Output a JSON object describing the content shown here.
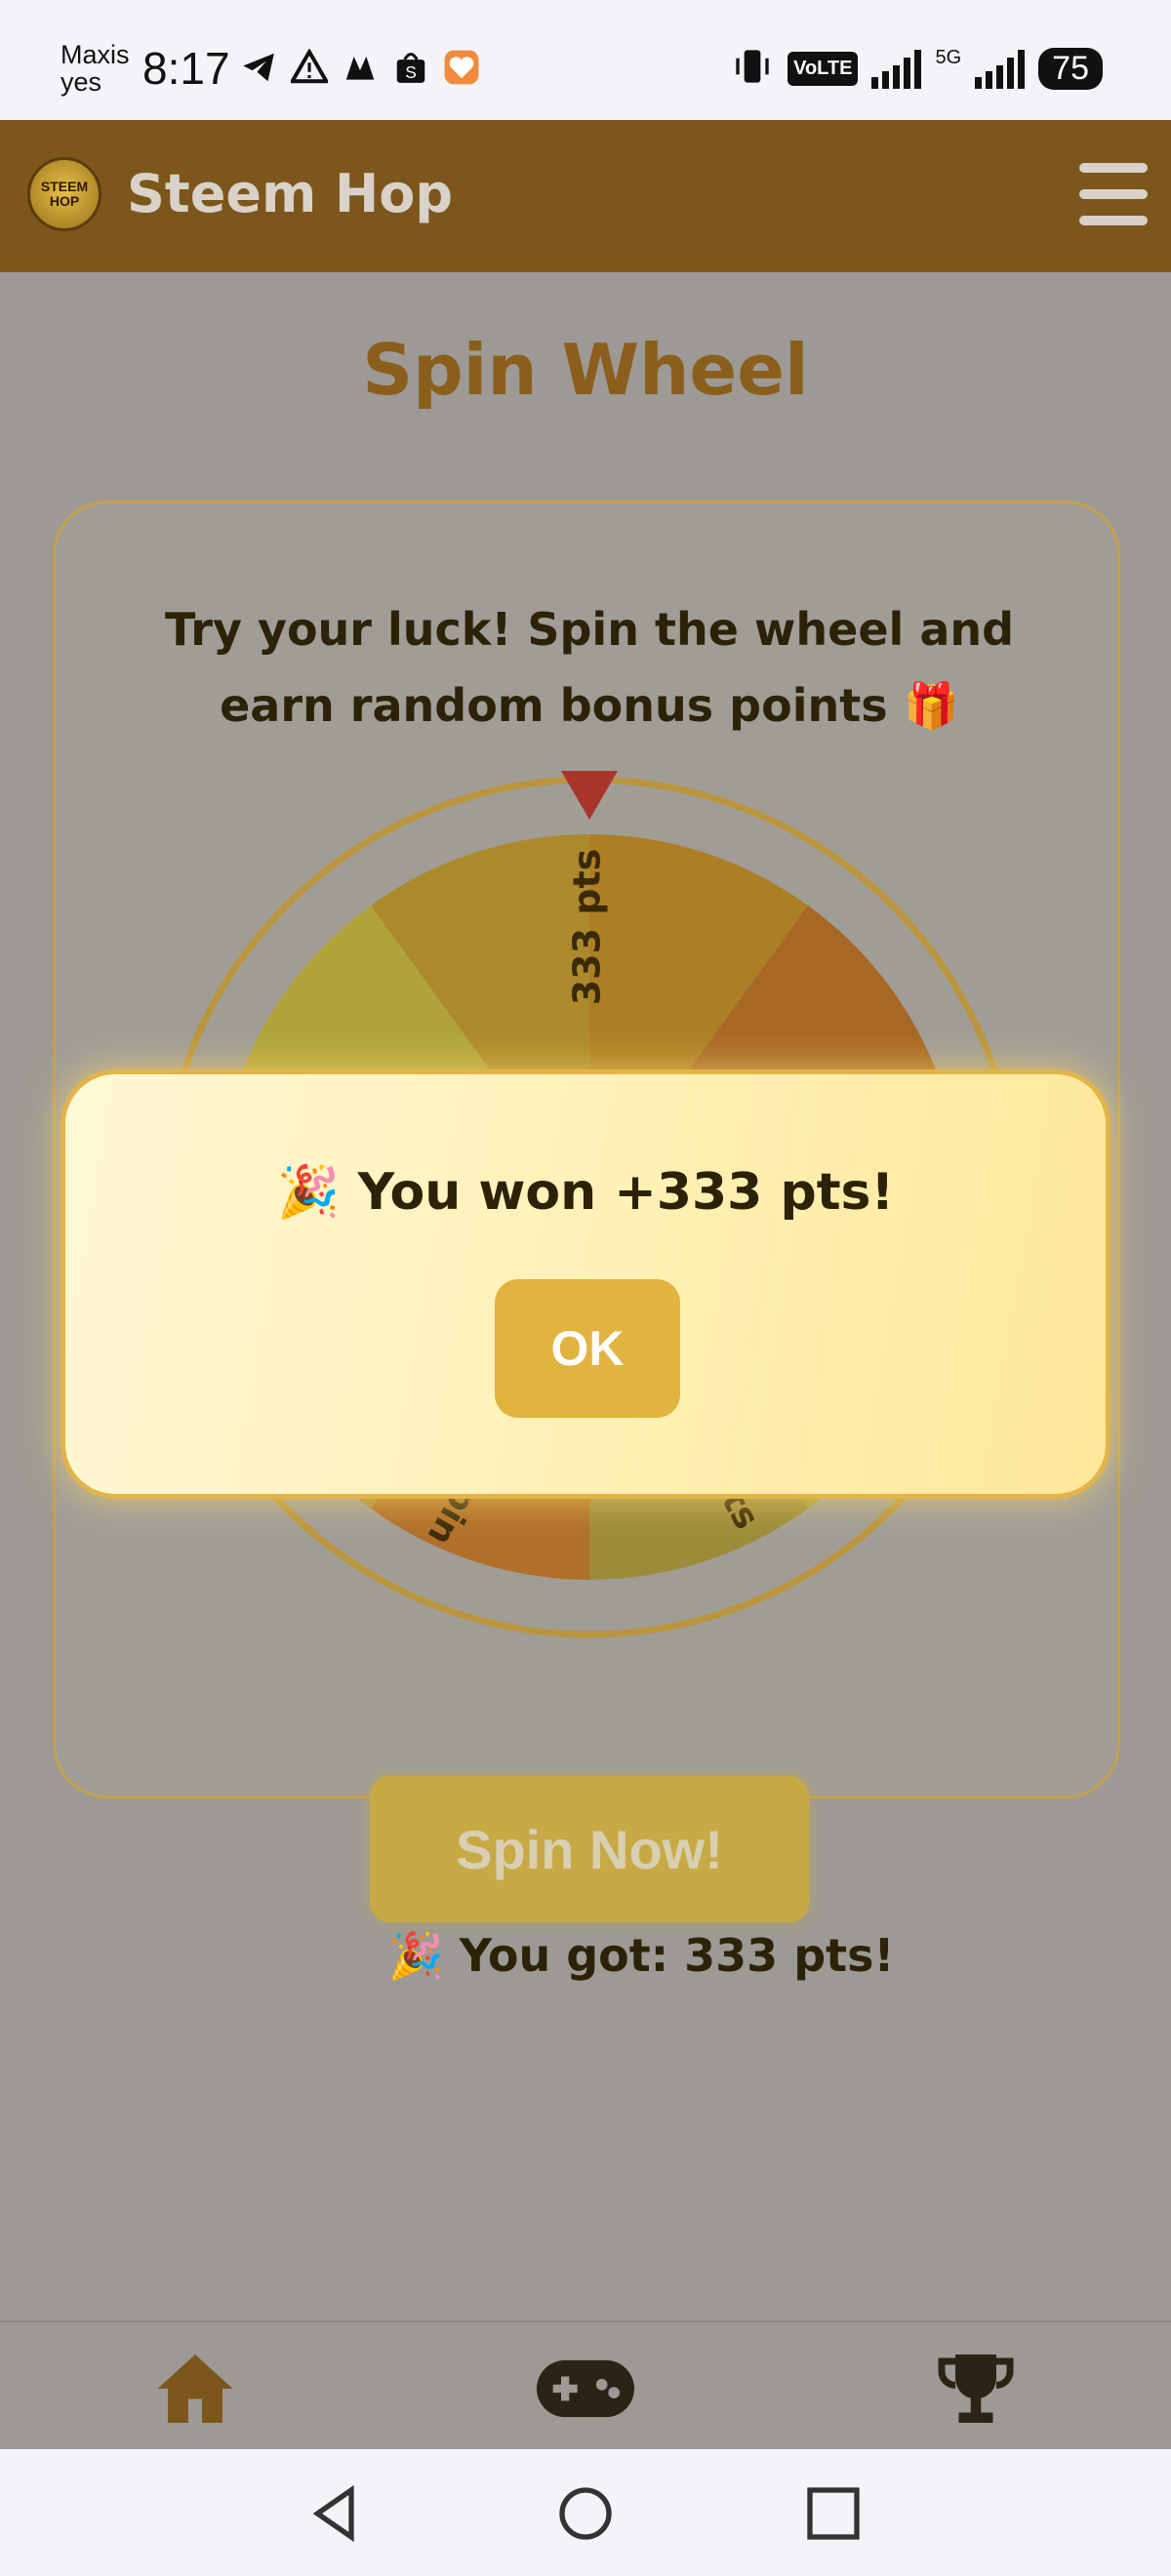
{
  "status_bar": {
    "carrier_line1": "Maxis",
    "carrier_line2": "yes",
    "time": "8:17",
    "volte": "VoLTE",
    "network": "5G",
    "battery": "75",
    "icons": [
      "telegram-icon",
      "warning-icon",
      "app-icon",
      "shopee-icon",
      "heart-app-icon",
      "vibrate-icon",
      "signal-icon",
      "signal-5g-icon"
    ]
  },
  "header": {
    "logo_text": "STEEM HOP",
    "title": "Steem Hop"
  },
  "page": {
    "title": "Spin Wheel",
    "description": "Try your luck! Spin the wheel and earn random bonus points 🎁",
    "wheel_visible_labels": [
      "333 pts",
      "pin",
      "ts"
    ],
    "spin_button": "Spin Now!",
    "result_text": "🎉 You got: 333 pts!"
  },
  "modal": {
    "message": "🎉 You won +333 pts!",
    "ok_label": "OK"
  },
  "bottom_nav": [
    "home-icon",
    "gamepad-icon",
    "trophy-icon"
  ],
  "colors": {
    "header_bg": "#7d561c",
    "accent_gold": "#e0b43e",
    "title_brown": "#8a5f1c"
  }
}
